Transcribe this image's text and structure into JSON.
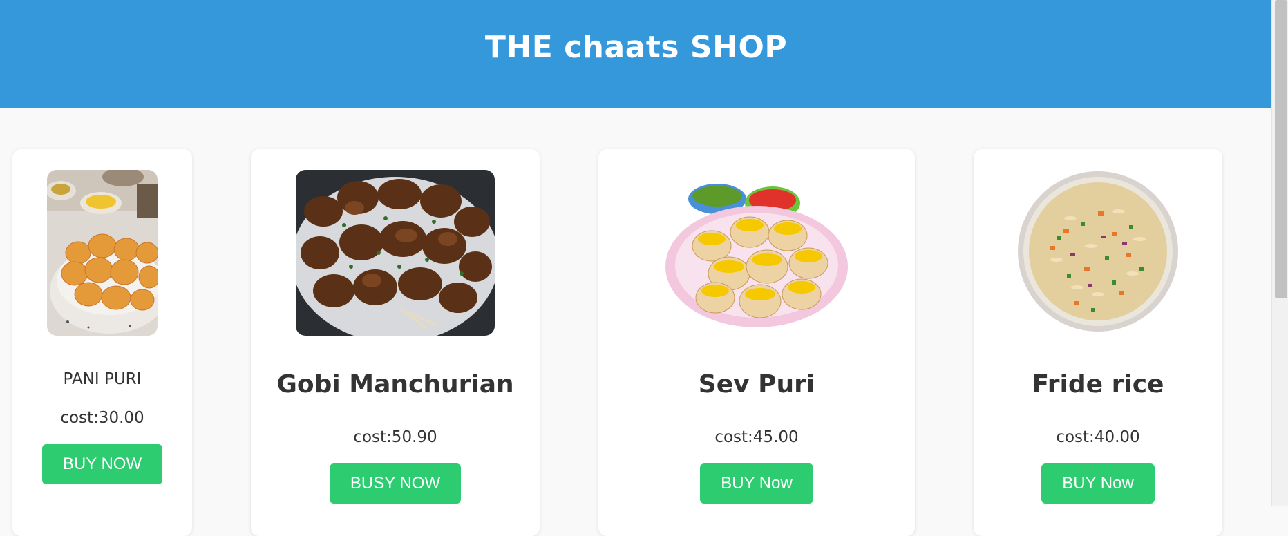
{
  "header": {
    "title": "THE chaats SHOP"
  },
  "products": [
    {
      "name": "PANI PURI",
      "cost": "cost:30.00",
      "button": "BUY NOW"
    },
    {
      "name": "Gobi Manchurian",
      "cost": "cost:50.90",
      "button": "BUSY NOW"
    },
    {
      "name": "Sev Puri",
      "cost": "cost:45.00",
      "button": "BUY Now"
    },
    {
      "name": "Fride rice",
      "cost": "cost:40.00",
      "button": "BUY Now"
    }
  ],
  "colors": {
    "header_bg": "#3498db",
    "button_bg": "#2ecc71",
    "page_bg": "#f9f9f9"
  }
}
